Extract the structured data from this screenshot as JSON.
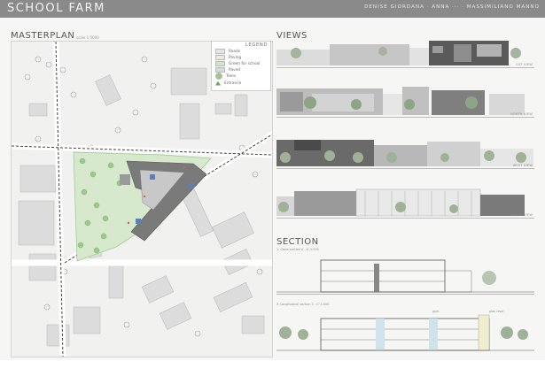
{
  "header": {
    "title": "SCHOOL FARM",
    "authors": "DENISE GIORDANA · ANNA ··· · MASSIMILIANO MANNO"
  },
  "masterplan": {
    "heading": "MASTERPLAN",
    "scale": "scale 1:5000",
    "legend": {
      "title": "LEGEND",
      "items": [
        {
          "label": "Roads",
          "color": "#e5e5e5"
        },
        {
          "label": "Paving",
          "color": "#ece9dc"
        },
        {
          "label": "Green for school",
          "color": "#cfe6c6"
        },
        {
          "label": "Paved",
          "color": "#d8d8d8"
        },
        {
          "label": "Trees",
          "color": "#9cc88e"
        },
        {
          "label": "Entrance",
          "color": "#6aa85c"
        }
      ]
    }
  },
  "views": {
    "heading": "VIEWS",
    "labels": [
      "EST VIEW",
      "NORTH VIEW",
      "WEST VIEW",
      "SOUTH VIEW"
    ]
  },
  "section": {
    "heading": "SECTION",
    "sub1": "1. Cross section A - A' 1:500",
    "sub2": "2. Longitudinal section C - C' 1:500",
    "tags": [
      "gym",
      "plan level"
    ]
  }
}
